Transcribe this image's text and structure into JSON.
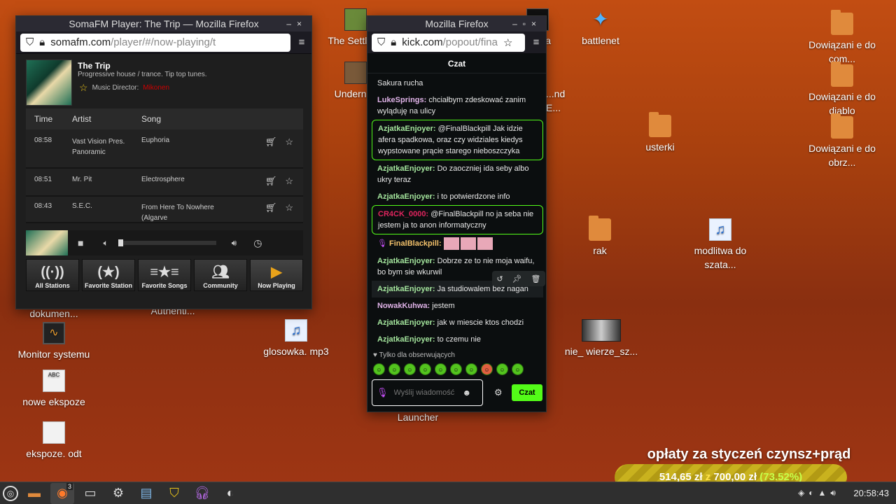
{
  "desktop": {
    "icons": [
      {
        "label": "The Settler...",
        "x": 0
      },
      {
        "label": "Underni...",
        "x": 0
      },
      {
        "label": "...nda ...xe",
        "x": 0
      },
      {
        "label": "...nd E...",
        "x": 0
      },
      {
        "label": "battlenet"
      },
      {
        "label": "Dowiązani e do com..."
      },
      {
        "label": "Dowiązani e do diablo"
      },
      {
        "label": "Dowiązani e do obrz..."
      },
      {
        "label": "usterki"
      },
      {
        "label": "rak"
      },
      {
        "label": "modlitwa do szata..."
      },
      {
        "label": "dokumen..."
      },
      {
        "label": "Authenti..."
      },
      {
        "label": "Monitor systemu"
      },
      {
        "label": "glosowka. mp3"
      },
      {
        "label": "nie_ wierze_sz..."
      },
      {
        "label": "nowe ekspoze"
      },
      {
        "label": "Launcher"
      },
      {
        "label": "ekspoze. odt"
      }
    ]
  },
  "soma": {
    "window_title": "SomaFM Player: The Trip — Mozilla Firefox",
    "url_main": "somafm.com",
    "url_path": "/player/#/now-playing/t",
    "station_title": "The Trip",
    "station_desc": "Progressive house / trance. Tip top tunes.",
    "director_label": "Music Director:",
    "director_name": "Mikonen",
    "headers": {
      "time": "Time",
      "artist": "Artist",
      "song": "Song"
    },
    "rows": [
      {
        "time": "08:58",
        "artist": "Vast Vision Pres. Panoramic",
        "song": "Euphoria"
      },
      {
        "time": "08:51",
        "artist": "Mr. Pit",
        "song": "Electrosphere"
      },
      {
        "time": "08:43",
        "artist": "S.E.C.",
        "song": "From Here To Nowhere (Algarve"
      }
    ],
    "volume": 0.05,
    "nav": [
      "All Stations",
      "Favorite Station",
      "Favorite Songs",
      "Community",
      "Now Playing"
    ]
  },
  "kick": {
    "window_title": "Mozilla Firefox",
    "url_main": "kick.com",
    "url_path": "/popout/fina",
    "chat_title": "Czat",
    "messages": [
      {
        "user": "",
        "text": "Sakura rucha"
      },
      {
        "user": "LukeSprings:",
        "text": "chciałbym zdeskować zanim wyląduję na ulicy"
      },
      {
        "user": "AzjatkaEnjoyer:",
        "text": "@FinalBlackpill Jak idzie afera spadkowa, oraz czy widziales kiedys wypstowane prącie starego nieboszczyka"
      },
      {
        "user": "AzjatkaEnjoyer:",
        "text": "Do zaoczniej ida seby albo ukry teraz"
      },
      {
        "user": "AzjatkaEnjoyer:",
        "text": "i to potwierdzone info"
      },
      {
        "user": "CR4CK_0000:",
        "text": "@FinalBlackpill no ja seba nie jestem ja to anon informatyczny"
      },
      {
        "user": "FinalBlackpill:",
        "text": ""
      },
      {
        "user": "AzjatkaEnjoyer:",
        "text": "Dobrze ze to nie moja waifu, bo bym sie wkurwil"
      },
      {
        "user": "AzjatkaEnjoyer:",
        "text": "Ja studiowalem bez nagan"
      },
      {
        "user": "NowakKuhwa:",
        "text": "jestem"
      },
      {
        "user": "AzjatkaEnjoyer:",
        "text": "jak w miescie ktos chodzi"
      },
      {
        "user": "AzjatkaEnjoyer:",
        "text": "to czemu nie"
      }
    ],
    "followers_only": "Tylko dla obserwujących",
    "input_placeholder": "Wyślij wiadomość",
    "send_label": "Czat"
  },
  "donation": {
    "title": "opłaty za styczeń czynsz+prąd",
    "current": "514,65 zł",
    "of": "z",
    "goal": "700,00 zł",
    "percent": "(73.52%)",
    "progress": 0.7352
  },
  "taskbar": {
    "clock": "20:58:43",
    "firefox_badge": "3"
  }
}
